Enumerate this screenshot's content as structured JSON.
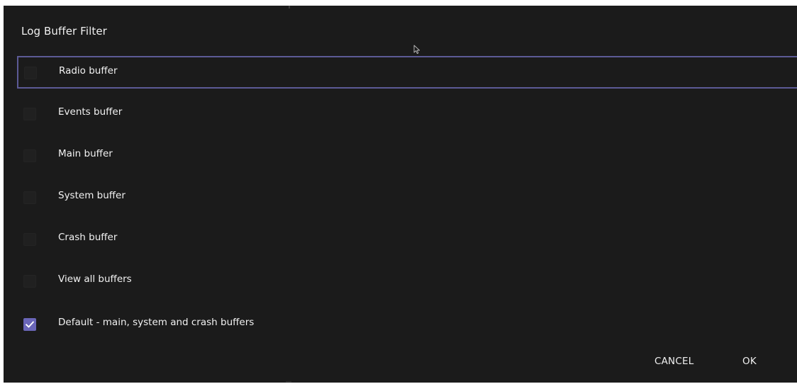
{
  "dialog": {
    "title": "Log Buffer Filter",
    "options": [
      {
        "label": "Radio buffer",
        "checked": false,
        "focused": true
      },
      {
        "label": "Events buffer",
        "checked": false,
        "focused": false
      },
      {
        "label": "Main buffer",
        "checked": false,
        "focused": false
      },
      {
        "label": "System buffer",
        "checked": false,
        "focused": false
      },
      {
        "label": "Crash buffer",
        "checked": false,
        "focused": false
      },
      {
        "label": "View all buffers",
        "checked": false,
        "focused": false
      },
      {
        "label": "Default - main, system and crash buffers",
        "checked": true,
        "focused": false
      }
    ],
    "buttons": {
      "cancel": "CANCEL",
      "ok": "OK"
    }
  },
  "colors": {
    "dialog_background": "#1b1b1b",
    "focus_border": "#5c5a96",
    "checkbox_checked": "#6a66b8",
    "checkbox_unchecked": "#202020",
    "text": "#f2f2f2"
  }
}
